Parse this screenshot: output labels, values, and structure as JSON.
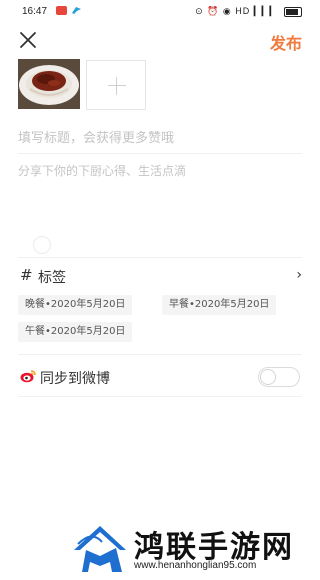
{
  "status_bar": {
    "time": "16:47",
    "indicators": "⊙ ⏰ ◉ HD ▎▎▎"
  },
  "header": {
    "close_icon": "close-icon",
    "publish_label": "发布"
  },
  "photos": {
    "add_icon": "plus-icon"
  },
  "form": {
    "title_placeholder": "填写标题，会获得更多赞哦",
    "desc_placeholder": "分享下你的下厨心得、生活点滴"
  },
  "tags": {
    "hash_symbol": "#",
    "label": "标签",
    "chevron": "›",
    "chips": [
      "晚餐•2020年5月20日",
      "早餐•2020年5月20日",
      "午餐•2020年5月20日"
    ]
  },
  "sync": {
    "label": "同步到微博",
    "icon": "weibo-icon",
    "enabled": false
  },
  "watermark": {
    "name": "鸿联手游网",
    "url": "www.henanhonglian95.com"
  },
  "colors": {
    "accent": "#f07b3f",
    "placeholder": "#c4c4c4",
    "chip_bg": "#f4f4f4"
  }
}
